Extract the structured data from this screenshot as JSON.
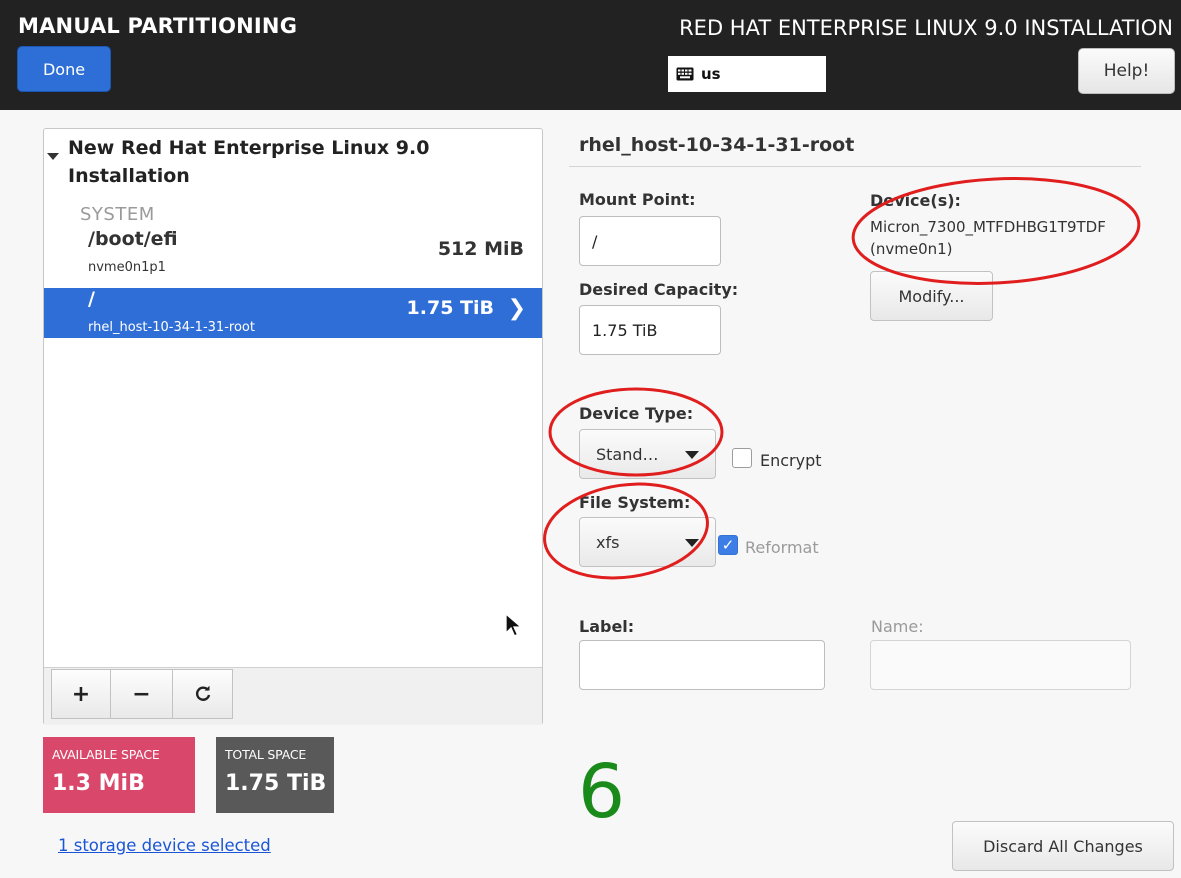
{
  "header": {
    "title": "MANUAL PARTITIONING",
    "product": "RED HAT ENTERPRISE LINUX 9.0 INSTALLATION",
    "done_label": "Done",
    "keyboard_layout": "us",
    "help_label": "Help!"
  },
  "partitions": {
    "install_title": "New Red Hat Enterprise Linux 9.0 Installation",
    "system_label": "SYSTEM",
    "rows": [
      {
        "mount": "/boot/efi",
        "device": "nvme0n1p1",
        "size": "512 MiB",
        "selected": false
      },
      {
        "mount": "/",
        "device": "rhel_host-10-34-1-31-root",
        "size": "1.75 TiB",
        "selected": true
      }
    ],
    "toolbar": {
      "add": "+",
      "remove": "−",
      "refresh": "⟳"
    }
  },
  "space": {
    "available_label": "AVAILABLE SPACE",
    "available_value": "1.3 MiB",
    "total_label": "TOTAL SPACE",
    "total_value": "1.75 TiB",
    "storage_link": "1 storage device selected"
  },
  "details": {
    "title": "rhel_host-10-34-1-31-root",
    "mount_point_label": "Mount Point:",
    "mount_point_value": "/",
    "capacity_label": "Desired Capacity:",
    "capacity_value": "1.75 TiB",
    "devices_label": "Device(s):",
    "devices_value": "Micron_7300_MTFDHBG1T9TDF (nvme0n1)",
    "modify_label": "Modify...",
    "device_type_label": "Device Type:",
    "device_type_value": "Stand…",
    "encrypt_label": "Encrypt",
    "file_system_label": "File System:",
    "file_system_value": "xfs",
    "reformat_label": "Reformat",
    "reformat_checked": true,
    "label_label": "Label:",
    "label_value": "",
    "name_label": "Name:",
    "name_value": "",
    "discard_label": "Discard All Changes"
  },
  "annotation": {
    "number": "6",
    "color": "#1a8a1a",
    "circle_color": "#e01e1e"
  },
  "colors": {
    "header_bg": "#222222",
    "accent": "#2f6ed6",
    "available_tile": "#d9476a",
    "total_tile": "#595959"
  }
}
